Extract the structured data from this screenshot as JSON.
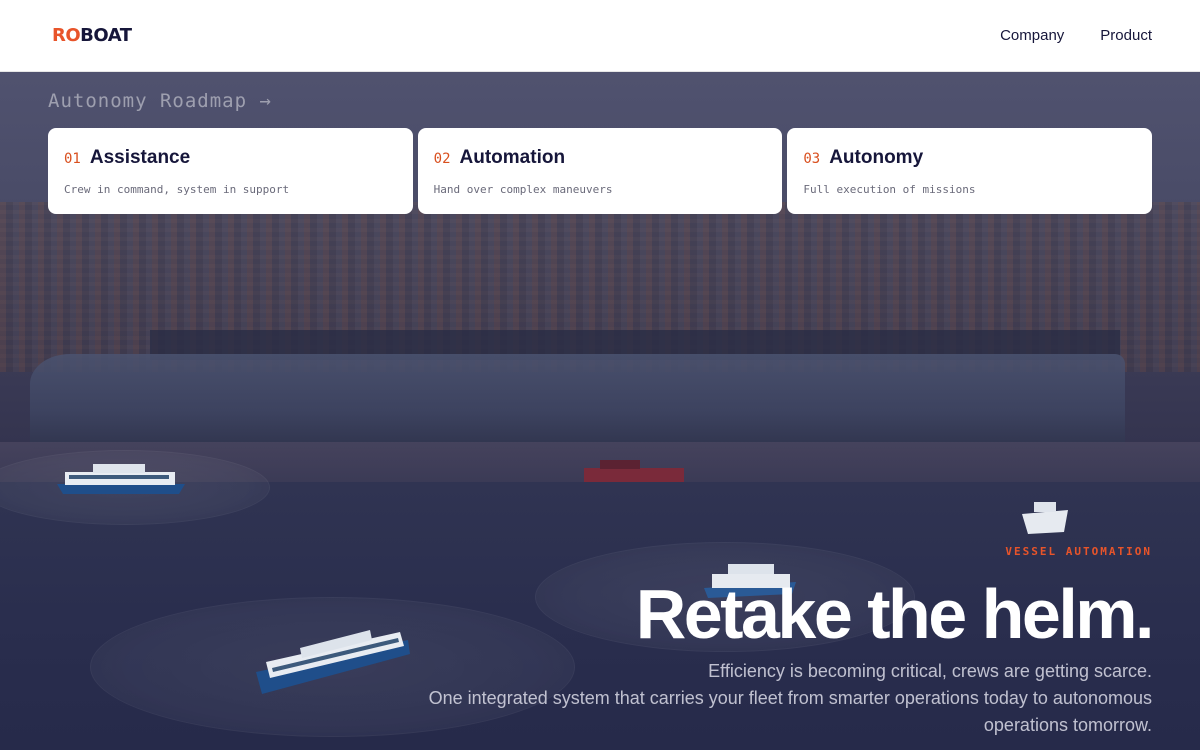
{
  "header": {
    "logo_part1": "RO",
    "logo_part2": "BOAT",
    "nav": [
      "Company",
      "Product"
    ]
  },
  "roadmap": {
    "title": "Autonomy Roadmap →",
    "cards": [
      {
        "num": "01",
        "title": "Assistance",
        "desc": "Crew in command, system in support"
      },
      {
        "num": "02",
        "title": "Automation",
        "desc": "Hand over complex maneuvers"
      },
      {
        "num": "03",
        "title": "Autonomy",
        "desc": "Full execution of missions"
      }
    ]
  },
  "hero": {
    "eyebrow": "VESSEL AUTOMATION",
    "headline": "Retake the helm.",
    "sub_line1": "Efficiency is becoming critical, crews are getting scarce.",
    "sub_line2": "One integrated system that carries your fleet from smarter operations today to autonomous operations tomorrow."
  },
  "colors": {
    "accent": "#e8542a",
    "brand_dark": "#16163a"
  }
}
